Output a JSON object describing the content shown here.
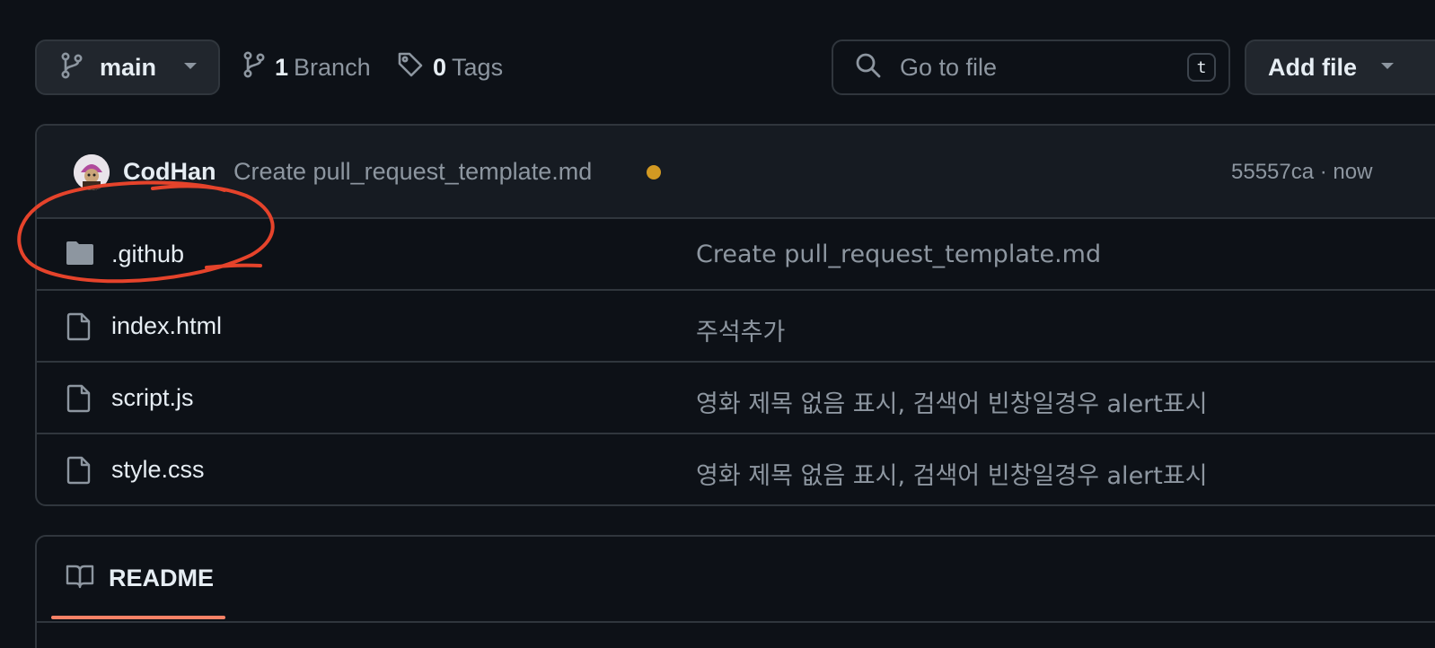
{
  "toolbar": {
    "branch_label": "main",
    "branch_count": "1",
    "branch_text": "Branch",
    "tag_count": "0",
    "tag_text": "Tags",
    "search_placeholder": "Go to file",
    "search_shortcut": "t",
    "add_file_label": "Add file"
  },
  "latest_commit": {
    "author": "CodHan",
    "message": "Create pull_request_template.md",
    "status": "pending",
    "hash_time": "55557ca · now"
  },
  "files": [
    {
      "type": "folder",
      "name": ".github",
      "message": "Create pull_request_template.md"
    },
    {
      "type": "file",
      "name": "index.html",
      "message": "주석추가"
    },
    {
      "type": "file",
      "name": "script.js",
      "message": "영화 제목 없음 표시, 검색어 빈창일경우 alert표시"
    },
    {
      "type": "file",
      "name": "style.css",
      "message": "영화 제목 없음 표시, 검색어 빈창일경우 alert표시"
    }
  ],
  "readme": {
    "tab_label": "README"
  },
  "colors": {
    "background": "#0d1117",
    "border": "#30363d",
    "muted_text": "#8d96a0",
    "status_pending": "#d29922",
    "tab_underline": "#f78166",
    "annotation": "#e5432b"
  },
  "annotation": {
    "shape": "hand-drawn-circle",
    "target": ".github"
  }
}
